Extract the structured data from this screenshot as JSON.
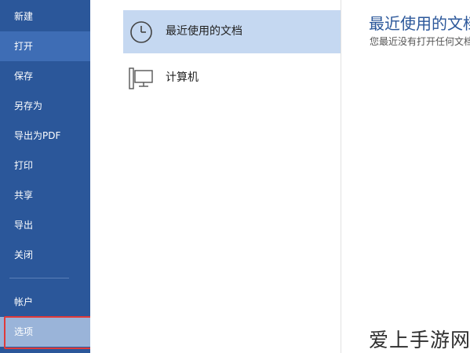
{
  "sidebar": {
    "items": [
      {
        "label": "新建"
      },
      {
        "label": "打开"
      },
      {
        "label": "保存"
      },
      {
        "label": "另存为"
      },
      {
        "label": "导出为PDF"
      },
      {
        "label": "打印"
      },
      {
        "label": "共享"
      },
      {
        "label": "导出"
      },
      {
        "label": "关闭"
      },
      {
        "label": "帐户"
      },
      {
        "label": "选项"
      }
    ]
  },
  "places": {
    "recent": {
      "label": "最近使用的文档",
      "icon": "clock-icon"
    },
    "computer": {
      "label": "计算机",
      "icon": "computer-icon"
    }
  },
  "content": {
    "title": "最近使用的文档",
    "description": "您最近没有打开任何文档。"
  },
  "watermark": {
    "text": "爱上手游网"
  },
  "colors": {
    "sidebar_bg": "#2b579a",
    "sidebar_active": "#3e6db5",
    "sidebar_selected": "#9ab4d9",
    "place_active": "#c5d8f1",
    "highlight_border": "#e03a3a"
  }
}
